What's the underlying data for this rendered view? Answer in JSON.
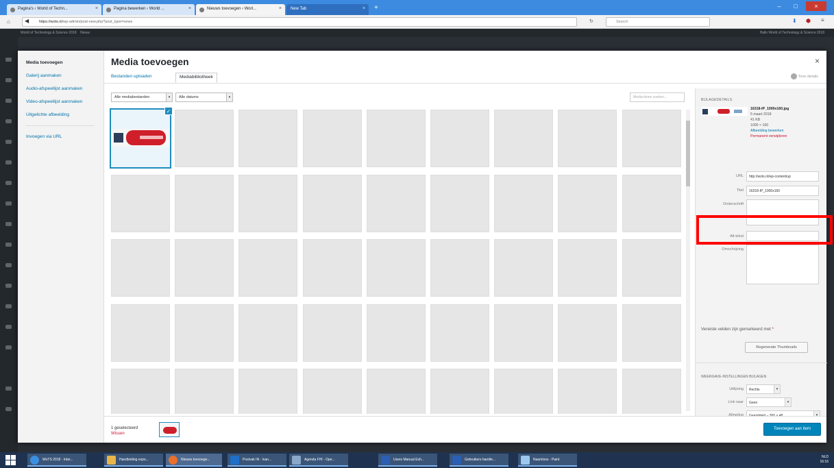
{
  "browser": {
    "tabs": [
      {
        "label": "Pagina's ‹ World of Techn..."
      },
      {
        "label": "Pagina bewerken ‹ World ..."
      },
      {
        "label": "Nieuws toevoegen ‹ Worl..."
      },
      {
        "label": "New Tab"
      }
    ],
    "url_host": "https://wots.nl",
    "url_path": "/wp-admin/post-new.php?post_type=news",
    "search_placeholder": "Search"
  },
  "adminbar": {
    "site": "World of Technology & Science 2018",
    "new_label": "Nieuw",
    "greeting": "Hallo World of Technology & Science 2018"
  },
  "modal": {
    "title": "Media toevoegen",
    "close_glyph": "×",
    "menu": [
      "Media toevoegen",
      "Galerij aanmaken",
      "Audio-afspeellijst aanmaken",
      "Video-afspeellijst aanmaken",
      "Uitgelichte afbeelding",
      "Invoegen via URL"
    ],
    "tabs": {
      "upload": "Bestanden uploaden",
      "library": "Mediabibliotheek"
    },
    "toon_details": "Toon details",
    "filter_type": "Alle mediabestanden",
    "filter_date": "Alle datums",
    "search_placeholder": "Media-items zoeken..."
  },
  "details": {
    "heading": "BIJLAGEDETAILS",
    "filename": "16318-IP_1000x160.jpg",
    "date": "5 maart 2018",
    "size": "41 KB",
    "dimensions": "1000 × 160",
    "edit_link": "Afbeelding bewerken",
    "delete_link": "Permanent verwijderen",
    "url_label": "URL",
    "url_value": "http://wots.nl/wp-content/up",
    "title_label": "Titel",
    "title_value": "16318-IP_1000x160",
    "caption_label": "Onderschrift",
    "alt_label": "Alt-tekst",
    "description_label": "Omschrijving",
    "required_text": "Vereiste velden zijn gemarkeerd met",
    "required_star": "*",
    "regenerate": "Regenerate Thumbnails",
    "display_heading": "WEERGAVE-INSTELLINGEN BIJLAGEN",
    "align_label": "Uitlijning",
    "align_value": "Rechts",
    "link_label": "Link naar",
    "link_value": "Geen",
    "size_label": "Afmeting",
    "size_value": "Gemiddeld – 300 × 48"
  },
  "footer": {
    "selected_count": "1 geselecteerd",
    "clear": "Wissen",
    "insert_button": "Toevoegen aan item"
  },
  "taskbar": {
    "items": [
      "WoTS 2018 - Inter...",
      "Handleiding expo...",
      "Nieuws toevoege...",
      "Postvak IN - Ivan...",
      "Agenda FHI - Ope...",
      "Users Manual Exh...",
      "Gebruikers handle...",
      "Naamloos - Paint"
    ],
    "lang": "NLD",
    "time": "16:16"
  },
  "colors": {
    "accent": "#0073aa",
    "primary_button": "#0085ba",
    "highlight": "#ff0000",
    "danger": "#c8102e"
  }
}
